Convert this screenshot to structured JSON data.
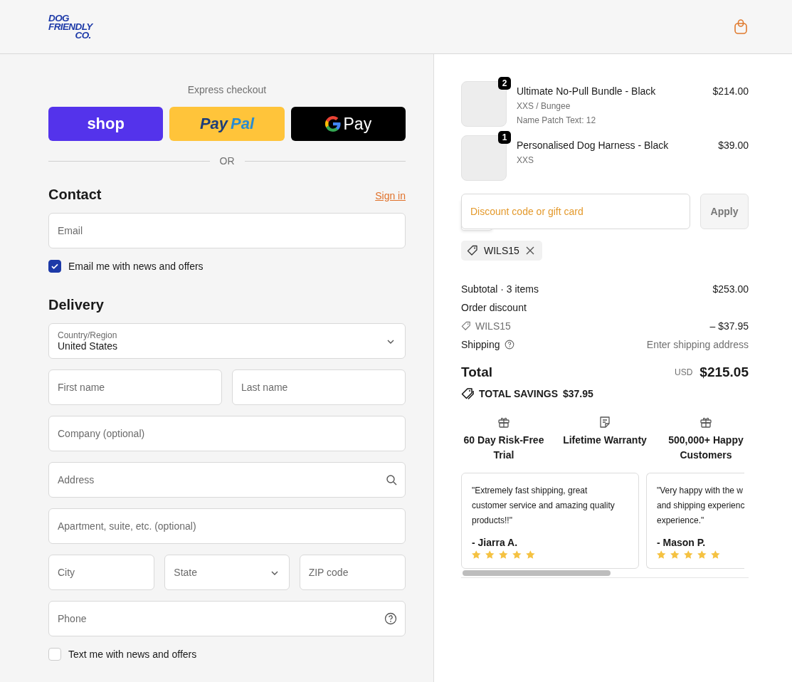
{
  "header": {
    "logo_lines": [
      "DOG",
      "FRIENDLY",
      "CO."
    ]
  },
  "express": {
    "title": "Express checkout",
    "buttons": [
      {
        "kind": "shop",
        "label": "shop"
      },
      {
        "kind": "paypal",
        "parts": [
          "Pay",
          "Pal"
        ]
      },
      {
        "kind": "gpay",
        "label": "Pay"
      }
    ],
    "divider": "OR"
  },
  "contact": {
    "title": "Contact",
    "link": "Sign in",
    "email": {
      "placeholder": "Email"
    },
    "newsletter": {
      "label": "Email me with news and offers",
      "checked": true
    }
  },
  "delivery": {
    "title": "Delivery",
    "rows": [
      [
        {
          "kind": "select",
          "label": "Country/Region",
          "value": "United States"
        }
      ],
      [
        {
          "kind": "text",
          "placeholder": "First name"
        },
        {
          "kind": "text",
          "placeholder": "Last name"
        }
      ],
      [
        {
          "kind": "text",
          "placeholder": "Company (optional)"
        }
      ],
      [
        {
          "kind": "search",
          "placeholder": "Address"
        }
      ],
      [
        {
          "kind": "text",
          "placeholder": "Apartment, suite, etc. (optional)"
        }
      ],
      [
        {
          "kind": "text",
          "placeholder": "City"
        },
        {
          "kind": "select",
          "placeholder": "State"
        },
        {
          "kind": "text",
          "placeholder": "ZIP code"
        }
      ],
      [
        {
          "kind": "help",
          "placeholder": "Phone"
        }
      ]
    ],
    "sms": {
      "label": "Text me with news and offers",
      "checked": false
    }
  },
  "cart": {
    "items": [
      {
        "quantity": "2",
        "name": "Ultimate No-Pull Bundle - Black",
        "details": [
          "XXS / Bungee",
          "Name Patch Text: 12"
        ],
        "price": "$214.00"
      },
      {
        "quantity": "1",
        "name": "Personalised Dog Harness - Black",
        "details": [
          "XXS"
        ],
        "price": "$39.00"
      }
    ],
    "discount": {
      "placeholder": "Discount code or gift card",
      "button": "Apply",
      "applied": "WILS15"
    },
    "summary": {
      "subtotal_label": "Subtotal · 3 items",
      "subtotal": "$253.00",
      "discount_label": "Order discount",
      "discount_code": "WILS15",
      "discount_amount": "– $37.95",
      "shipping_label": "Shipping",
      "shipping_value": "Enter shipping address",
      "total_label": "Total",
      "currency": "USD",
      "total": "$215.05",
      "savings_label": "TOTAL SAVINGS",
      "savings": "$37.95"
    },
    "perks": [
      {
        "kind": "gift",
        "label": "60 Day Risk-Free Trial"
      },
      {
        "kind": "note",
        "label": "Lifetime Warranty"
      },
      {
        "kind": "gift",
        "label": "500,000+ Happy Customers"
      }
    ],
    "reviews": [
      {
        "lines": [
          "\"Extremely fast shipping, great",
          "customer service and amazing quality",
          "products!!\""
        ],
        "author": "- Jiarra A.",
        "stars": 5
      },
      {
        "lines": [
          "\"Very happy with the w",
          "and shipping experienc",
          "experience.\""
        ],
        "author": "- Mason P.",
        "stars": 5
      }
    ]
  }
}
